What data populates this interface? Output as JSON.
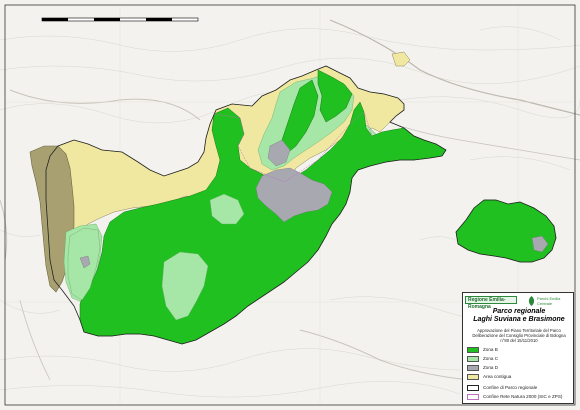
{
  "map": {
    "colors": {
      "zona_b": "#20c020",
      "zona_c": "#a6e6a6",
      "zona_d": "#a8a8b0",
      "area_contigua": "#f0e8a0",
      "lago": "#a8a070",
      "boundary": "#222222"
    },
    "place_label": "",
    "scale_bar": {
      "label_left": "",
      "label_mid": "",
      "label_right": ""
    },
    "grid_top": [
      "",
      "",
      ""
    ],
    "grid_left": [
      "",
      ""
    ]
  },
  "legend": {
    "logo_left_text": "Regione Emilia-Romagna",
    "logo_right_text": "Parchi Emilia Centrale",
    "title_line1": "Parco regionale",
    "title_line2": "Laghi Suviana e Brasimone",
    "subtitle_line1": "Approvazione del Piano Territoriale del Parco",
    "subtitle_line2": "Deliberazione del Consiglio Provinciale di Bologna",
    "subtitle_line3": "n°80 del 15/11/2010",
    "items": [
      {
        "label": "Zona B",
        "color": "#20c020"
      },
      {
        "label": "Zona C",
        "color": "#a6e6a6"
      },
      {
        "label": "Zona D",
        "color": "#a8a8b0"
      },
      {
        "label": "Area contigua",
        "color": "#f0e8a0"
      },
      {
        "label": "Confine di Parco regionale",
        "color": "#ffffff"
      },
      {
        "label": "Confine Rete Natura 2000 (SIC e ZPS)",
        "color": "#ffffff"
      }
    ]
  }
}
